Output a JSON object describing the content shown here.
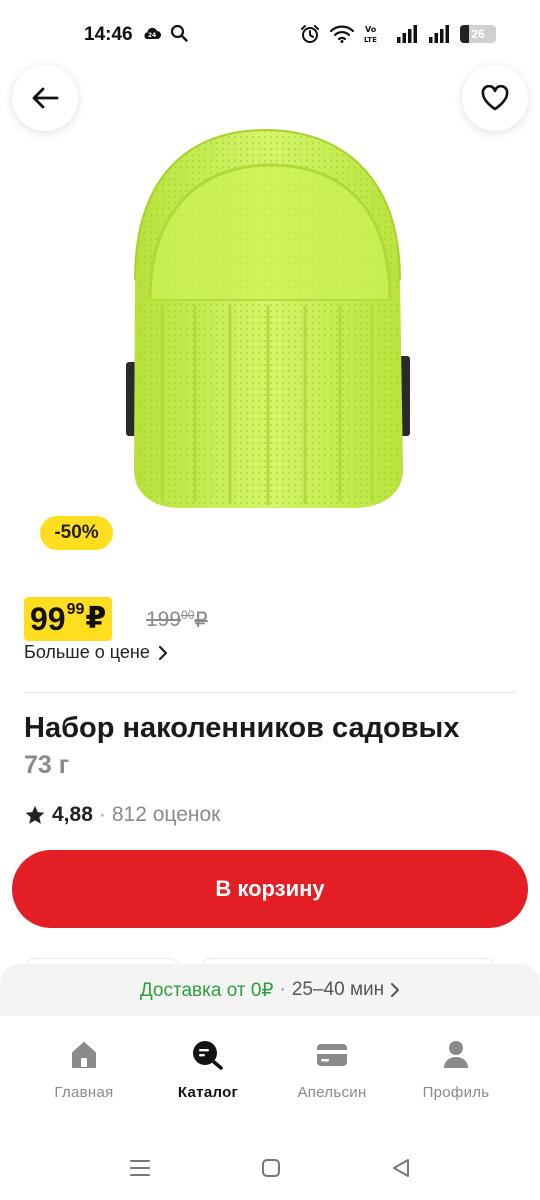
{
  "status_bar": {
    "time": "14:46",
    "battery_level": "26",
    "icons": [
      "cloud-24-icon",
      "search-icon",
      "alarm-icon",
      "wifi-icon",
      "volte-icon",
      "signal-icon",
      "signal-icon",
      "battery-icon"
    ]
  },
  "header": {
    "back_icon": "arrow-left-icon",
    "favorite_icon": "heart-outline-icon"
  },
  "product": {
    "image_icon": "knee-pad-image",
    "discount_badge": "-50%",
    "price": {
      "main": "99",
      "cents": "99",
      "currency": "₽"
    },
    "old_price": {
      "main": "199",
      "cents": "00",
      "currency": "₽"
    },
    "more_about_price": "Больше о цене",
    "title": "Набор наколенников садовых",
    "weight": "73 г",
    "rating": {
      "value": "4,88",
      "separator": "·",
      "count": "812 оценок"
    },
    "add_to_cart": "В корзину"
  },
  "delivery": {
    "free_text": "Доставка от 0₽",
    "separator": "·",
    "time": "25–40 мин"
  },
  "bottom_nav": {
    "items": [
      {
        "label": "Главная",
        "icon": "home-icon",
        "active": false
      },
      {
        "label": "Каталог",
        "icon": "catalog-search-icon",
        "active": true
      },
      {
        "label": "Апельсин",
        "icon": "card-icon",
        "active": false
      },
      {
        "label": "Профиль",
        "icon": "profile-icon",
        "active": false
      }
    ]
  },
  "system_nav": [
    "menu-icon",
    "home-square-icon",
    "back-triangle-icon"
  ],
  "colors": {
    "accent_red": "#e31e24",
    "price_yellow": "#ffdd1f",
    "delivery_green": "#2e9e3e",
    "product_lime": "#c8f04a"
  }
}
